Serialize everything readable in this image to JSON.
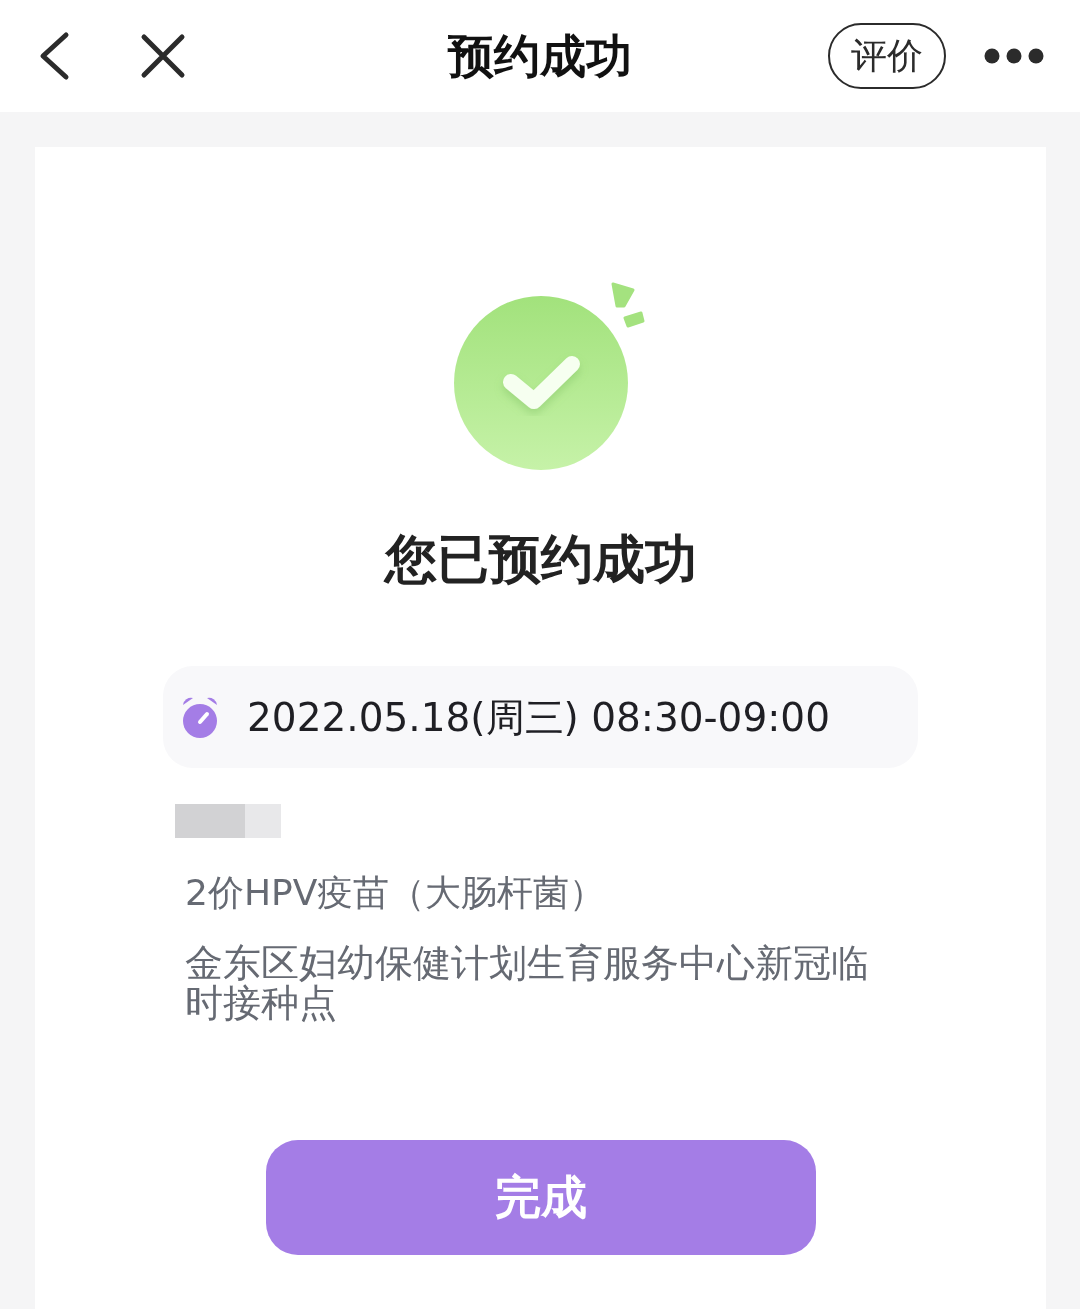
{
  "nav": {
    "title": "预约成功",
    "rate_button": "评价"
  },
  "result": {
    "heading": "您已预约成功"
  },
  "appointment": {
    "time": "2022.05.18(周三) 08:30-09:00",
    "vaccine": "2价HPV疫苗（大肠杆菌）",
    "site": "金东区妇幼保健计划生育服务中心新冠临时接种点"
  },
  "done_button": "完成"
}
